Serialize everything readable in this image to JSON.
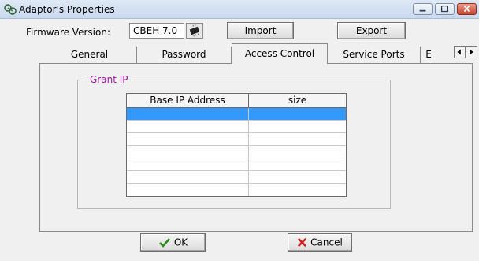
{
  "window": {
    "title": "Adaptor's Properties",
    "controls": [
      "minimize-icon",
      "maximize-icon",
      "close-icon"
    ]
  },
  "firmware": {
    "label": "Firmware Version:",
    "value": "CBEH 7.0",
    "chip_icon": "chip-icon"
  },
  "toolbar": {
    "import_label": "Import",
    "export_label": "Export"
  },
  "tabs": [
    {
      "label": "General",
      "active": false
    },
    {
      "label": "Password",
      "active": false
    },
    {
      "label": "Access Control",
      "active": true
    },
    {
      "label": "Service Ports",
      "active": false
    },
    {
      "label": "E",
      "active": false
    }
  ],
  "grant_ip": {
    "group_label": "Grant  IP",
    "columns": [
      "Base IP Address",
      "size"
    ],
    "rows": [
      [
        "",
        ""
      ],
      [
        "",
        ""
      ],
      [
        "",
        ""
      ],
      [
        "",
        ""
      ],
      [
        "",
        ""
      ],
      [
        "",
        ""
      ],
      [
        "",
        ""
      ]
    ],
    "selected_row": 0,
    "selection_color": "#3399ff"
  },
  "footer": {
    "ok_label": "OK",
    "cancel_label": "Cancel"
  },
  "colors": {
    "group_label": "#9a1a9a",
    "ok_check": "#2e8b1e",
    "cancel_x": "#cc2222"
  }
}
